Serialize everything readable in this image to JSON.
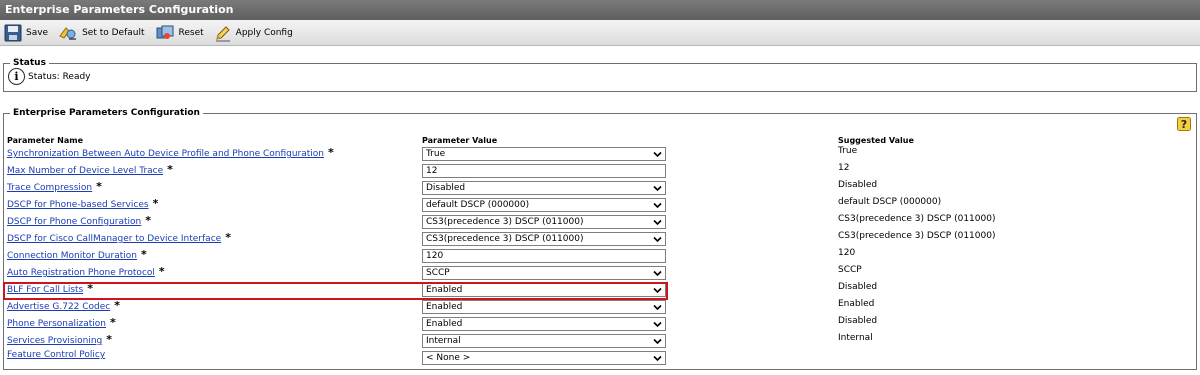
{
  "window": {
    "title": "Enterprise Parameters Configuration"
  },
  "toolbar": {
    "save_label": "Save",
    "set_default_label": "Set to Default",
    "reset_label": "Reset",
    "apply_label": "Apply Config",
    "icons": [
      "save-icon",
      "set-to-default-icon",
      "reset-icon",
      "apply-config-icon"
    ]
  },
  "status": {
    "legend": "Status",
    "text": "Status: Ready",
    "icon": "info-icon"
  },
  "config": {
    "legend": "Enterprise Parameters Configuration",
    "help_icon": "help-icon",
    "headers": {
      "name": "Parameter Name",
      "value": "Parameter Value",
      "suggested": "Suggested Value"
    },
    "required_marker": "*",
    "rows": [
      {
        "name": "Synchronization Between Auto Device Profile and Phone Configuration",
        "value": "True",
        "kind": "select",
        "suggested": "True",
        "required": true
      },
      {
        "name": "Max Number of Device Level Trace",
        "value": "12",
        "kind": "input",
        "suggested": "12",
        "required": true
      },
      {
        "name": "Trace Compression",
        "value": "Disabled",
        "kind": "select",
        "suggested": "Disabled",
        "required": true
      },
      {
        "name": "DSCP for Phone-based Services",
        "value": "default DSCP (000000)",
        "kind": "select",
        "suggested": "default DSCP (000000)",
        "required": true
      },
      {
        "name": "DSCP for Phone Configuration",
        "value": "CS3(precedence 3) DSCP (011000)",
        "kind": "select",
        "suggested": "CS3(precedence 3) DSCP (011000)",
        "required": true
      },
      {
        "name": "DSCP for Cisco CallManager to Device Interface",
        "value": "CS3(precedence 3) DSCP (011000)",
        "kind": "select",
        "suggested": "CS3(precedence 3) DSCP (011000)",
        "required": true
      },
      {
        "name": "Connection Monitor Duration",
        "value": "120",
        "kind": "input",
        "suggested": "120",
        "required": true
      },
      {
        "name": "Auto Registration Phone Protocol",
        "value": "SCCP",
        "kind": "select",
        "suggested": "SCCP",
        "required": true
      },
      {
        "name": "BLF For Call Lists",
        "value": "Enabled",
        "kind": "select",
        "suggested": "Disabled",
        "required": true,
        "highlighted": true
      },
      {
        "name": "Advertise G.722 Codec",
        "value": "Enabled",
        "kind": "select",
        "suggested": "Enabled",
        "required": true
      },
      {
        "name": "Phone Personalization",
        "value": "Enabled",
        "kind": "select",
        "suggested": "Disabled",
        "required": true
      },
      {
        "name": "Services Provisioning",
        "value": "Internal",
        "kind": "select",
        "suggested": "Internal",
        "required": true
      },
      {
        "name": "Feature Control Policy",
        "value": "< None >",
        "kind": "select",
        "suggested": "",
        "required": false
      }
    ]
  },
  "colors": {
    "title_bar": "#666666",
    "link": "#1a3db6",
    "highlight": "#d0121b"
  }
}
